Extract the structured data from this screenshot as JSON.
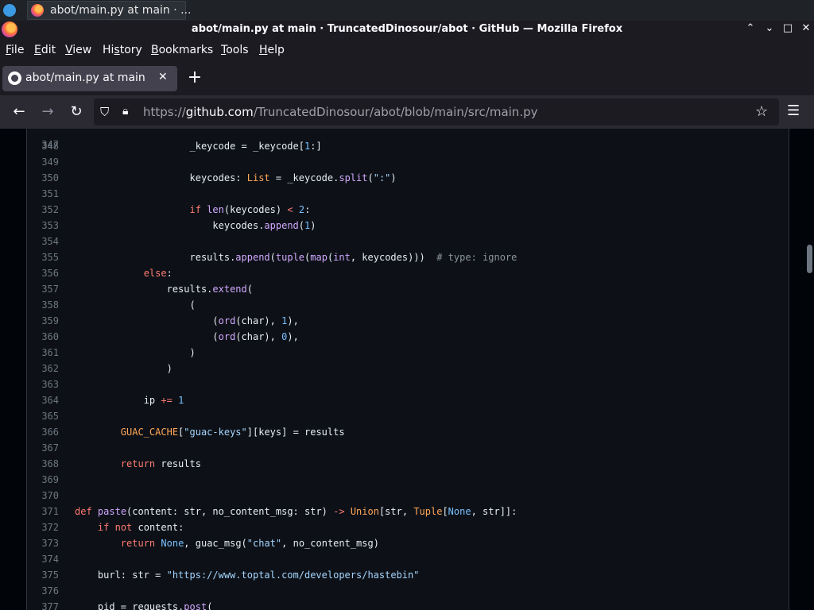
{
  "taskbar": {
    "task_label": "abot/main.py at main · ..."
  },
  "window": {
    "title": "abot/main.py at main · TruncatedDinosour/abot · GitHub — Mozilla Firefox",
    "controls": [
      "⌃",
      "⌄",
      "□",
      "✕"
    ]
  },
  "menu": {
    "items": [
      {
        "key": "F",
        "rest": "ile"
      },
      {
        "key": "E",
        "rest": "dit"
      },
      {
        "key": "V",
        "rest": "iew"
      },
      {
        "pre": "Hi",
        "key": "s",
        "rest": "tory"
      },
      {
        "key": "B",
        "rest": "ookmarks"
      },
      {
        "key": "T",
        "rest": "ools"
      },
      {
        "key": "H",
        "rest": "elp"
      }
    ]
  },
  "tab": {
    "label": "abot/main.py at main · Tr",
    "close": "✕",
    "new": "+"
  },
  "urlbar": {
    "prefix": "https://",
    "host": "github.com",
    "path": "/TruncatedDinosour/abot/blob/main/src/main.py"
  },
  "code": {
    "partial_top_line": "347",
    "lines": [
      {
        "n": "348",
        "t": [
          [
            "",
            "                    _keycode = _keycode["
          ],
          [
            "num",
            "1"
          ],
          [
            "",
            ":]"
          ]
        ]
      },
      {
        "n": "349",
        "t": []
      },
      {
        "n": "350",
        "t": [
          [
            "",
            "                    keycodes: "
          ],
          [
            "typ",
            "List"
          ],
          [
            "",
            " = _keycode."
          ],
          [
            "fn",
            "split"
          ],
          [
            "",
            "("
          ],
          [
            "str",
            "\":\""
          ],
          [
            "",
            ")"
          ]
        ]
      },
      {
        "n": "351",
        "t": []
      },
      {
        "n": "352",
        "t": [
          [
            "",
            "                    "
          ],
          [
            "kw",
            "if"
          ],
          [
            "",
            " "
          ],
          [
            "fn",
            "len"
          ],
          [
            "",
            "(keycodes) "
          ],
          [
            "op",
            "<"
          ],
          [
            "",
            " "
          ],
          [
            "num",
            "2"
          ],
          [
            "",
            ":"
          ]
        ]
      },
      {
        "n": "353",
        "t": [
          [
            "",
            "                        keycodes."
          ],
          [
            "fn",
            "append"
          ],
          [
            "",
            "("
          ],
          [
            "num",
            "1"
          ],
          [
            "",
            ")"
          ]
        ]
      },
      {
        "n": "354",
        "t": []
      },
      {
        "n": "355",
        "t": [
          [
            "",
            "                    results."
          ],
          [
            "fn",
            "append"
          ],
          [
            "",
            "("
          ],
          [
            "fn",
            "tuple"
          ],
          [
            "",
            "("
          ],
          [
            "fn",
            "map"
          ],
          [
            "",
            "("
          ],
          [
            "fn",
            "int"
          ],
          [
            "",
            ", keycodes)))  "
          ],
          [
            "cm",
            "# type: ignore"
          ]
        ]
      },
      {
        "n": "356",
        "t": [
          [
            "",
            "            "
          ],
          [
            "kw",
            "else"
          ],
          [
            "",
            ":"
          ]
        ]
      },
      {
        "n": "357",
        "t": [
          [
            "",
            "                results."
          ],
          [
            "fn",
            "extend"
          ],
          [
            "",
            "("
          ]
        ]
      },
      {
        "n": "358",
        "t": [
          [
            "",
            "                    ("
          ]
        ]
      },
      {
        "n": "359",
        "t": [
          [
            "",
            "                        ("
          ],
          [
            "fn",
            "ord"
          ],
          [
            "",
            "(char), "
          ],
          [
            "num",
            "1"
          ],
          [
            "",
            "),"
          ]
        ]
      },
      {
        "n": "360",
        "t": [
          [
            "",
            "                        ("
          ],
          [
            "fn",
            "ord"
          ],
          [
            "",
            "(char), "
          ],
          [
            "num",
            "0"
          ],
          [
            "",
            "),"
          ]
        ]
      },
      {
        "n": "361",
        "t": [
          [
            "",
            "                    )"
          ]
        ]
      },
      {
        "n": "362",
        "t": [
          [
            "",
            "                )"
          ]
        ]
      },
      {
        "n": "363",
        "t": []
      },
      {
        "n": "364",
        "t": [
          [
            "",
            "            ip "
          ],
          [
            "op",
            "+="
          ],
          [
            "",
            " "
          ],
          [
            "num",
            "1"
          ]
        ]
      },
      {
        "n": "365",
        "t": []
      },
      {
        "n": "366",
        "t": [
          [
            "",
            "        "
          ],
          [
            "typ",
            "GUAC_CACHE"
          ],
          [
            "",
            "["
          ],
          [
            "str",
            "\"guac-keys\""
          ],
          [
            "",
            "][keys] = results"
          ]
        ]
      },
      {
        "n": "367",
        "t": []
      },
      {
        "n": "368",
        "t": [
          [
            "",
            "        "
          ],
          [
            "kw",
            "return"
          ],
          [
            "",
            " results"
          ]
        ]
      },
      {
        "n": "369",
        "t": []
      },
      {
        "n": "370",
        "t": []
      },
      {
        "n": "371",
        "t": [
          [
            "kw",
            "def"
          ],
          [
            "",
            " "
          ],
          [
            "fn",
            "paste"
          ],
          [
            "",
            "(content: str, no_content_msg: str) "
          ],
          [
            "op",
            "->"
          ],
          [
            "",
            " "
          ],
          [
            "typ",
            "Union"
          ],
          [
            "",
            "[str, "
          ],
          [
            "typ",
            "Tuple"
          ],
          [
            "",
            "["
          ],
          [
            "num",
            "None"
          ],
          [
            "",
            ", str]]:"
          ]
        ]
      },
      {
        "n": "372",
        "t": [
          [
            "",
            "    "
          ],
          [
            "kw",
            "if"
          ],
          [
            "",
            " "
          ],
          [
            "kw",
            "not"
          ],
          [
            "",
            " content:"
          ]
        ]
      },
      {
        "n": "373",
        "t": [
          [
            "",
            "        "
          ],
          [
            "kw",
            "return"
          ],
          [
            "",
            " "
          ],
          [
            "num",
            "None"
          ],
          [
            "",
            ", guac_msg("
          ],
          [
            "str",
            "\"chat\""
          ],
          [
            "",
            ", no_content_msg)"
          ]
        ]
      },
      {
        "n": "374",
        "t": []
      },
      {
        "n": "375",
        "t": [
          [
            "",
            "    burl: str = "
          ],
          [
            "str",
            "\"https://www.toptal.com/developers/hastebin\""
          ]
        ]
      },
      {
        "n": "376",
        "t": []
      },
      {
        "n": "377",
        "t": [
          [
            "",
            "    pid = requests."
          ],
          [
            "fn",
            "post"
          ],
          [
            "",
            "("
          ]
        ]
      }
    ]
  }
}
